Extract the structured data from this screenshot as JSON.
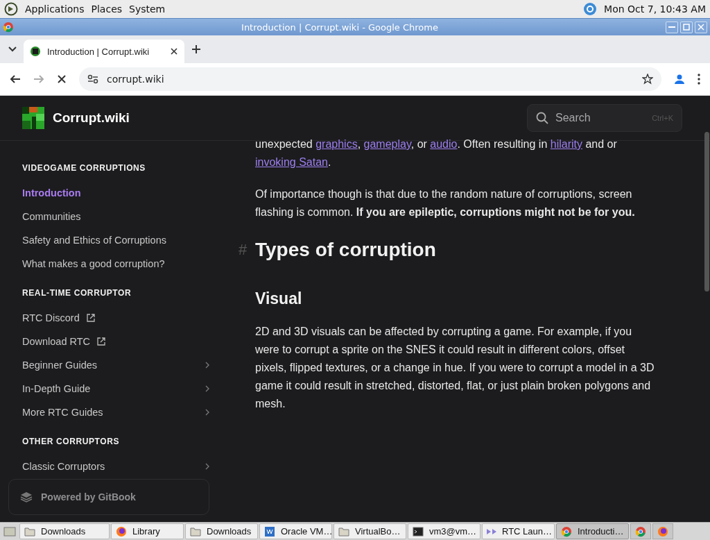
{
  "top_panel": {
    "menus": [
      "Applications",
      "Places",
      "System"
    ],
    "clock": "Mon Oct 7, 10:43 AM"
  },
  "window": {
    "title": "Introduction | Corrupt.wiki - Google Chrome"
  },
  "browser": {
    "tabs": [
      {
        "label": "Introduction | Corrupt.wiki",
        "selected": true
      }
    ],
    "url": "corrupt.wiki",
    "loading": true
  },
  "site": {
    "name": "Corrupt.wiki",
    "search": {
      "placeholder": "Search",
      "shortcut": "Ctrl+K"
    }
  },
  "sidebar": {
    "sections": [
      {
        "title": "VIDEOGAME CORRUPTIONS",
        "items": [
          {
            "label": "Introduction",
            "kind": "page",
            "selected": true
          },
          {
            "label": "Communities",
            "kind": "page",
            "selected": false
          },
          {
            "label": "Safety and Ethics of Corruptions",
            "kind": "page",
            "selected": false
          },
          {
            "label": "What makes a good corruption?",
            "kind": "page",
            "selected": false
          }
        ]
      },
      {
        "title": "REAL-TIME CORRUPTOR",
        "items": [
          {
            "label": "RTC Discord",
            "kind": "external",
            "selected": false
          },
          {
            "label": "Download RTC",
            "kind": "external",
            "selected": false
          },
          {
            "label": "Beginner Guides",
            "kind": "expandable",
            "selected": false
          },
          {
            "label": "In-Depth Guide",
            "kind": "expandable",
            "selected": false
          },
          {
            "label": "More RTC Guides",
            "kind": "expandable",
            "selected": false
          }
        ]
      },
      {
        "title": "OTHER CORRUPTORS",
        "items": [
          {
            "label": "Classic Corruptors",
            "kind": "expandable",
            "selected": false
          }
        ]
      }
    ],
    "footer": "Powered by GitBook"
  },
  "content": [
    {
      "kind": "paragraph",
      "segments": [
        {
          "kind": "text",
          "text": "unexpected "
        },
        {
          "kind": "link",
          "text": "graphics"
        },
        {
          "kind": "text",
          "text": ", "
        },
        {
          "kind": "link",
          "text": "gameplay"
        },
        {
          "kind": "text",
          "text": ", or "
        },
        {
          "kind": "link",
          "text": "audio"
        },
        {
          "kind": "text",
          "text": ". Often resulting in "
        },
        {
          "kind": "link",
          "text": "hilarity"
        },
        {
          "kind": "text",
          "text": " and or "
        },
        {
          "kind": "link",
          "text": "invoking Satan"
        },
        {
          "kind": "text",
          "text": "."
        }
      ]
    },
    {
      "kind": "paragraph",
      "segments": [
        {
          "kind": "text",
          "text": "Of importance though is that due to the random nature of corruptions, screen flashing is common. "
        },
        {
          "kind": "bold",
          "text": "If you are epileptic, corruptions might not be for you."
        }
      ]
    },
    {
      "kind": "heading",
      "anchor": "#",
      "text": "Types of corruption"
    },
    {
      "kind": "subheading",
      "text": "Visual"
    },
    {
      "kind": "paragraph",
      "segments": [
        {
          "kind": "text",
          "text": "2D and 3D visuals can be affected by corrupting a game. For example, if you were to corrupt a sprite on the SNES it could result in different colors, offset pixels, flipped textures, or a change in hue. If you were to corrupt a model in a 3D game it could result in stretched, distorted, flat, or just plain broken polygons and mesh."
        }
      ]
    }
  ],
  "taskbar": {
    "windows": [
      {
        "label": "Downloads",
        "kind": "folder",
        "selected": false
      },
      {
        "label": "Library",
        "kind": "firefox",
        "selected": false
      },
      {
        "label": "Downloads",
        "kind": "folder",
        "selected": false
      },
      {
        "label": "Oracle VM…",
        "kind": "vbox",
        "selected": false
      },
      {
        "label": "VirtualBo…",
        "kind": "folder",
        "selected": false
      },
      {
        "label": "vm3@vm…",
        "kind": "terminal",
        "selected": false
      },
      {
        "label": "RTC Laun…",
        "kind": "rtc",
        "selected": false
      },
      {
        "label": "Introducti…",
        "kind": "chrome",
        "selected": true
      }
    ],
    "launchers": [
      {
        "kind": "chrome"
      },
      {
        "kind": "firefox"
      }
    ]
  }
}
